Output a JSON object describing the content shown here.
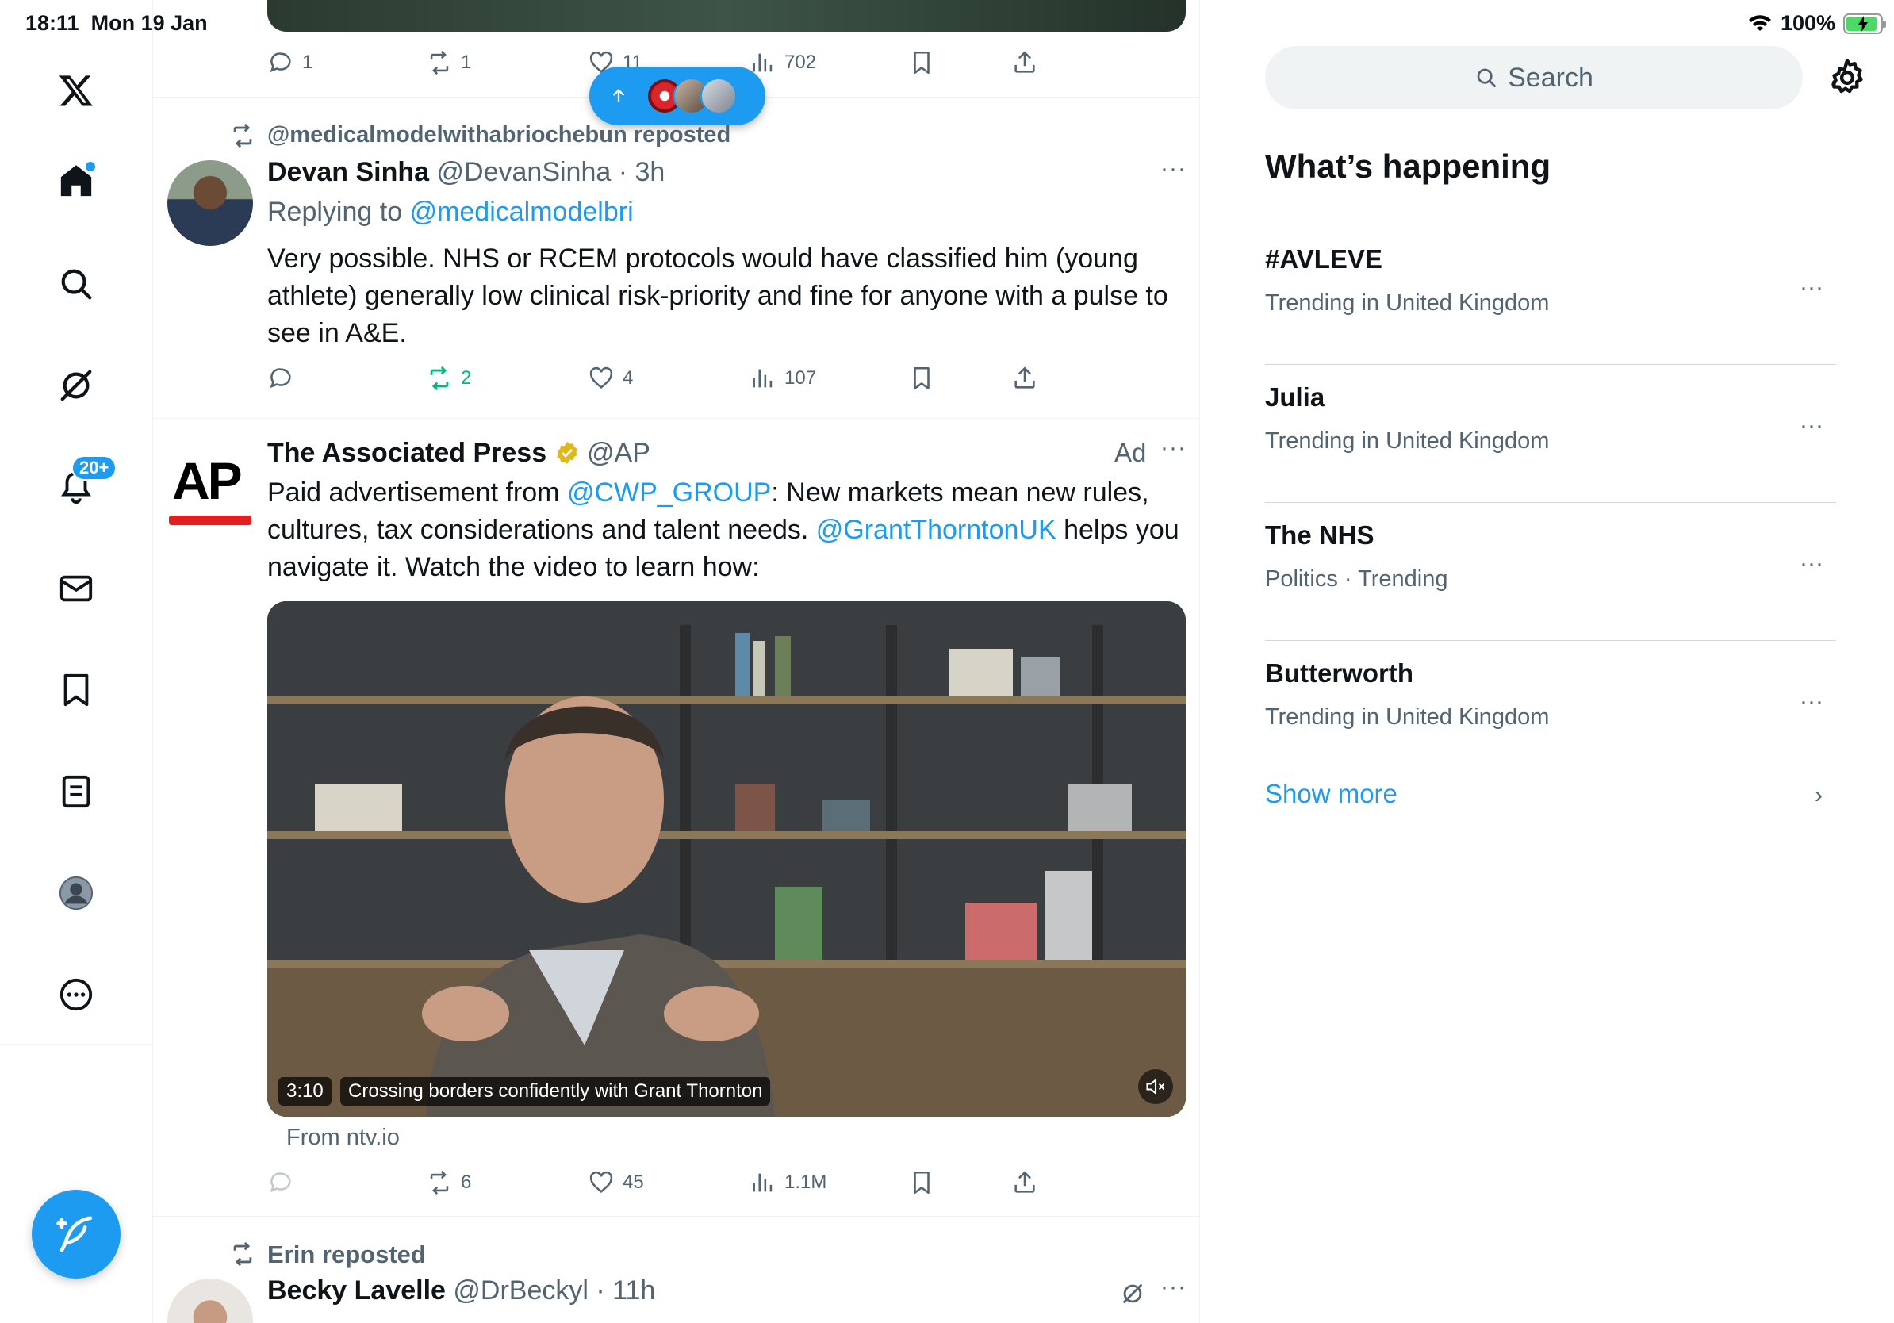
{
  "status": {
    "time": "18:11",
    "date": "Mon 19 Jan",
    "battery": "100%"
  },
  "nav": {
    "notifications_badge": "20+"
  },
  "feed": {
    "top_actions": {
      "replies": "1",
      "reposts": "1",
      "likes": "11",
      "views": "702"
    },
    "post1": {
      "repost_label": "@medicalmodelwithabriochebun reposted",
      "name": "Devan Sinha",
      "handle": "@DevanSinha",
      "time": "3h",
      "replying_prefix": "Replying to",
      "replying_to": "@medicalmodelbri",
      "body_lines": [
        "Very possible. NHS or RCEM protocols would have classified him (young",
        "athlete) generally low clinical risk-priority and fine for anyone with a pulse to",
        "see in A&E."
      ],
      "reposts": "2",
      "likes": "4",
      "views": "107"
    },
    "ad": {
      "logo": "AP",
      "name": "The Associated Press",
      "handle": "@AP",
      "ad_label": "Ad",
      "line1_prefix": "Paid advertisement from ",
      "line1_link": "@CWP_GROUP",
      "line1_suffix": ": New markets mean new rules,",
      "line2_prefix": "cultures, tax considerations and talent needs. ",
      "line2_link": "@GrantThorntonUK",
      "line2_suffix": " helps you",
      "line3": "navigate it. Watch the video to learn how:",
      "video_duration": "3:10",
      "video_title": "Crossing borders confidently with Grant Thornton",
      "source": "From ntv.io",
      "reposts": "6",
      "likes": "45",
      "views": "1.1M"
    },
    "post3": {
      "repost_label": "Erin reposted",
      "name": "Becky Lavelle",
      "handle": "@DrBeckyl",
      "time": "11h"
    }
  },
  "right": {
    "search_placeholder": "Search",
    "section_title": "What’s happening",
    "trends": [
      {
        "name": "#AVLEVE",
        "meta": "Trending in United Kingdom"
      },
      {
        "name": "Julia",
        "meta": "Trending in United Kingdom"
      },
      {
        "name": "The NHS",
        "meta": "Politics · Trending"
      },
      {
        "name": "Butterworth",
        "meta": "Trending in United Kingdom"
      }
    ],
    "show_more": "Show more"
  },
  "colors": {
    "accent": "#1d9bf0",
    "repost_green": "#00ba7c",
    "muted": "#536471",
    "ap_red": "#e0201f"
  }
}
